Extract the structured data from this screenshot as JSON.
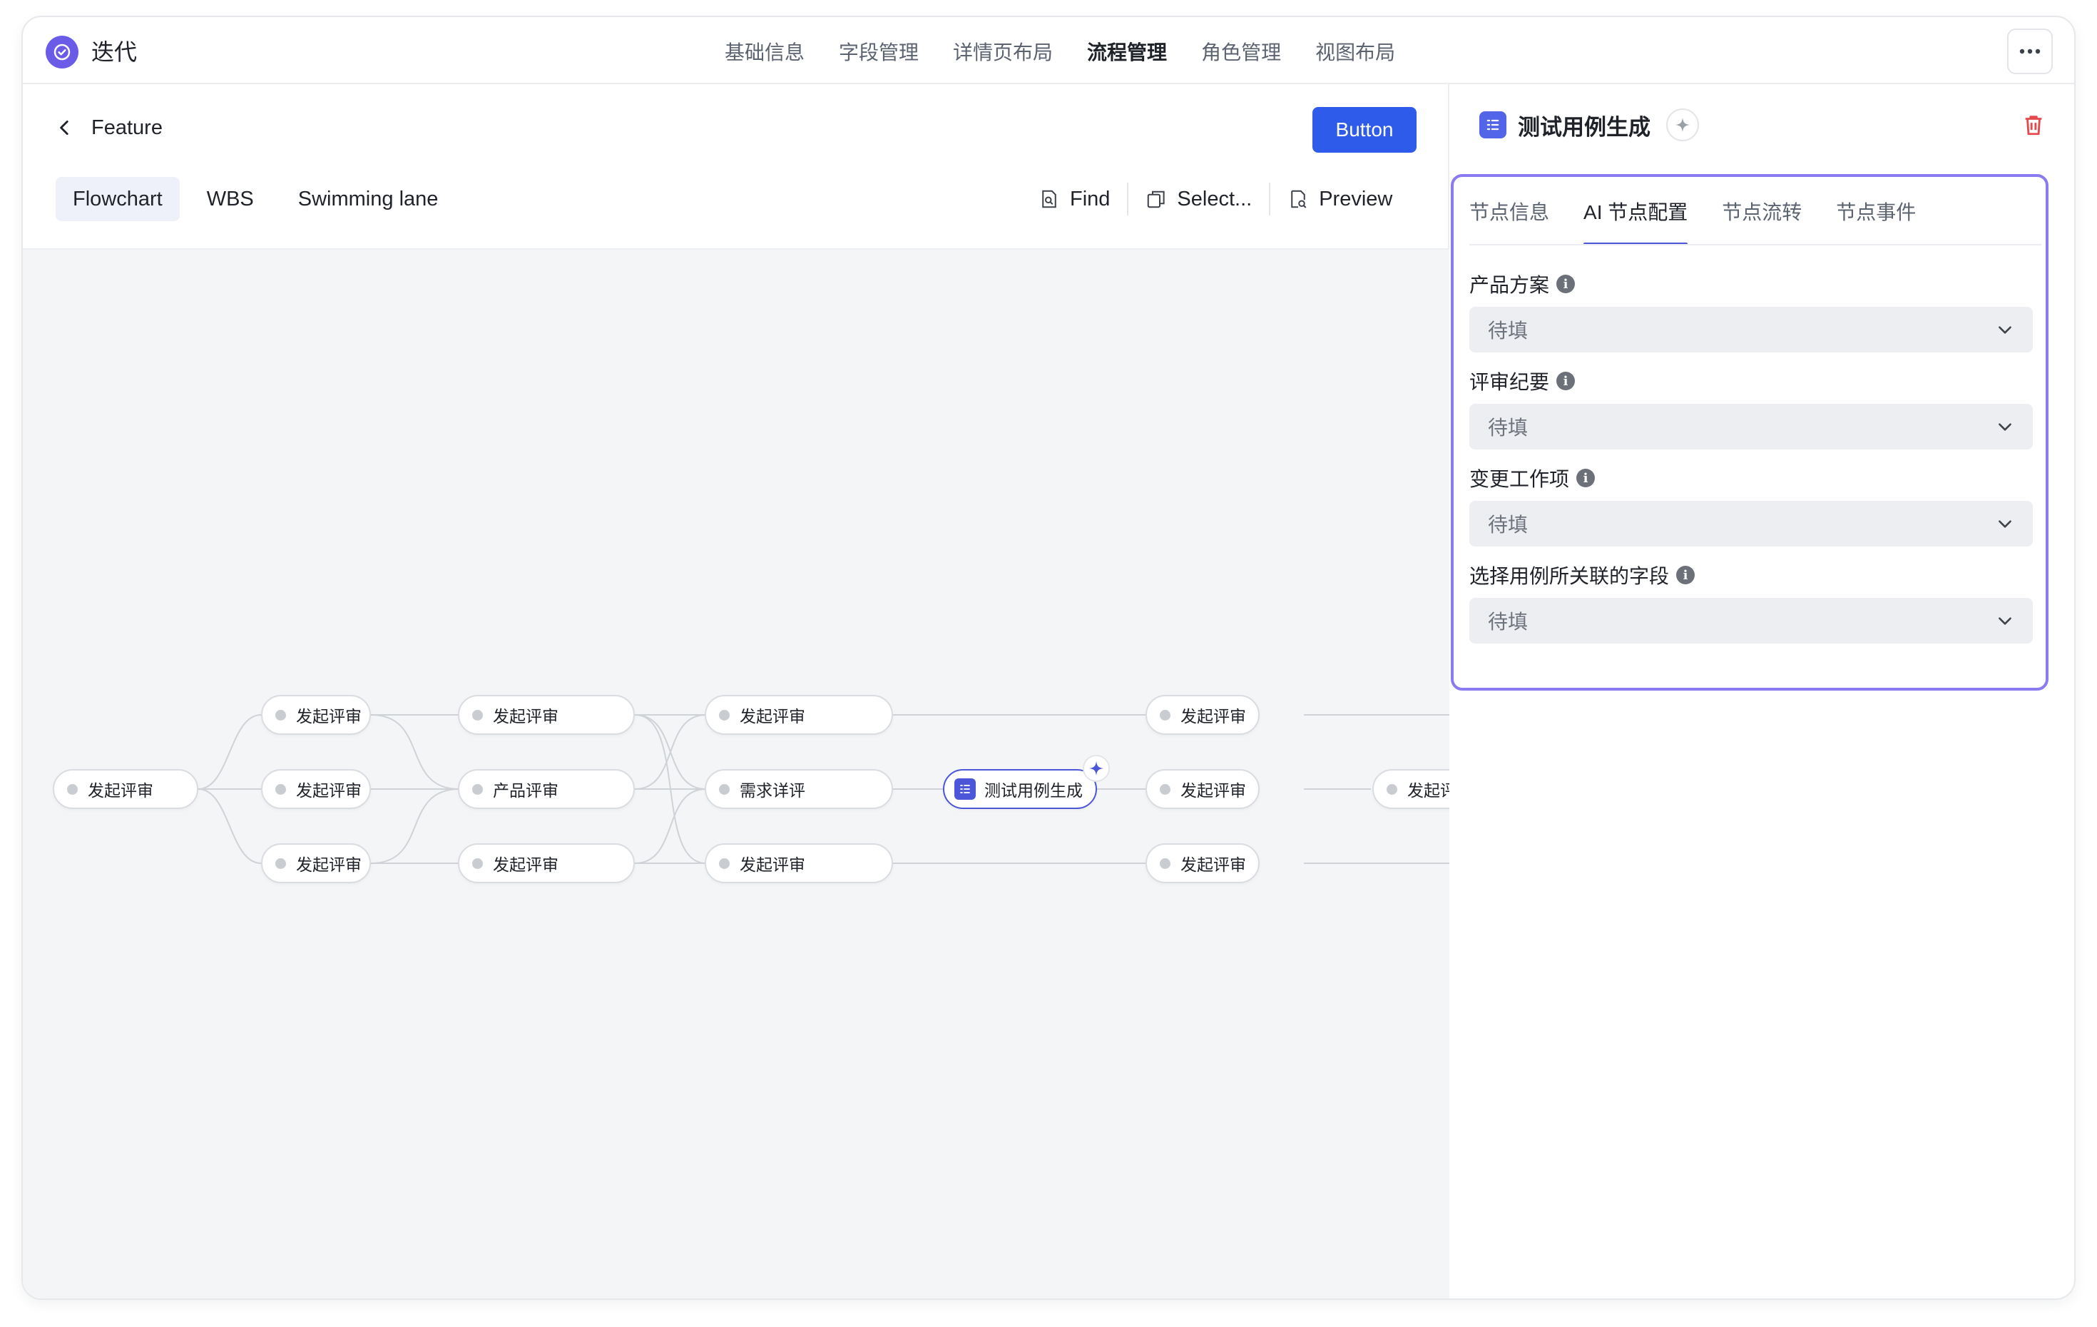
{
  "app": {
    "title": "迭代"
  },
  "topnav": [
    {
      "label": "基础信息"
    },
    {
      "label": "字段管理"
    },
    {
      "label": "详情页布局"
    },
    {
      "label": "流程管理",
      "active": true
    },
    {
      "label": "角色管理"
    },
    {
      "label": "视图布局"
    }
  ],
  "header": {
    "back_label": "Feature",
    "button_label": "Button"
  },
  "views": [
    {
      "label": "Flowchart",
      "active": true
    },
    {
      "label": "WBS"
    },
    {
      "label": "Swimming lane"
    }
  ],
  "tools": {
    "find": "Find",
    "select": "Select...",
    "preview": "Preview"
  },
  "flow": {
    "nodes": {
      "start": "发起评审",
      "c1_top": "发起评审",
      "c1_mid": "发起评审",
      "c1_bot": "发起评审",
      "c2_top": "发起评审",
      "c2_mid": "产品评审",
      "c2_bot": "发起评审",
      "c3_top": "发起评审",
      "c3_mid": "需求详评",
      "c3_bot": "发起评审",
      "ai": "测试用例生成",
      "c5_top": "发起评审",
      "c5_mid": "发起评审",
      "c5_bot": "发起评审",
      "c6_mid": "发起评审"
    }
  },
  "panel": {
    "title": "测试用例生成",
    "tabs": [
      {
        "label": "节点信息"
      },
      {
        "label": "AI 节点配置",
        "active": true
      },
      {
        "label": "节点流转"
      },
      {
        "label": "节点事件"
      }
    ],
    "fields": [
      {
        "label": "产品方案",
        "placeholder": "待填"
      },
      {
        "label": "评审纪要",
        "placeholder": "待填"
      },
      {
        "label": "变更工作项",
        "placeholder": "待填"
      },
      {
        "label": "选择用例所关联的字段",
        "placeholder": "待填"
      }
    ]
  },
  "colors": {
    "accent": "#2f5bea",
    "ai_accent": "#4c56d8",
    "config_border": "#8a7cf0",
    "logo": "#6b5ce7",
    "danger": "#e5484d"
  },
  "icons": [
    "check-circle-icon",
    "more-icon",
    "chevron-left-icon",
    "find-icon",
    "select-icon",
    "preview-icon",
    "sparkle-icon",
    "list-icon",
    "trash-icon",
    "info-icon",
    "chevron-down-icon"
  ]
}
